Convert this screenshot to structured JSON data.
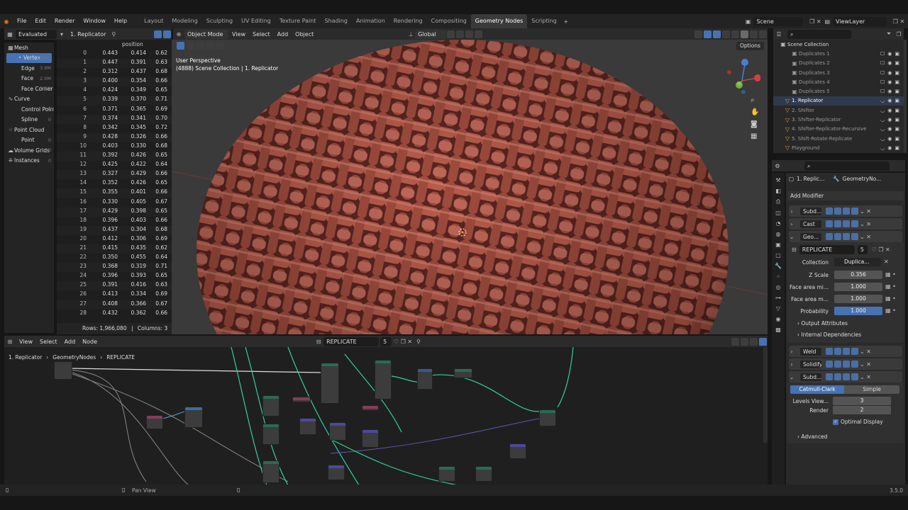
{
  "menu": [
    "File",
    "Edit",
    "Render",
    "Window",
    "Help"
  ],
  "workspaces": [
    "Layout",
    "Modeling",
    "Sculpting",
    "UV Editing",
    "Texture Paint",
    "Shading",
    "Animation",
    "Rendering",
    "Compositing",
    "Geometry Nodes",
    "Scripting"
  ],
  "active_workspace": "Geometry Nodes",
  "scene_name": "Scene",
  "view_layer": "ViewLayer",
  "spreadsheet": {
    "evaluated": "Evaluated",
    "object": "1. Replicator",
    "column_header": "position",
    "sidebar": [
      {
        "label": "Mesh",
        "count": ""
      },
      {
        "label": "Vertex",
        "count": "2.0M"
      },
      {
        "label": "Edge",
        "count": "3.9M"
      },
      {
        "label": "Face",
        "count": "2.0M"
      },
      {
        "label": "Face Corner",
        "count": "7.9M"
      },
      {
        "label": "Curve",
        "count": ""
      },
      {
        "label": "Control Point",
        "count": "0"
      },
      {
        "label": "Spline",
        "count": "0"
      },
      {
        "label": "Point Cloud",
        "count": ""
      },
      {
        "label": "Point",
        "count": "0"
      },
      {
        "label": "Volume Grids",
        "count": "0"
      },
      {
        "label": "Instances",
        "count": "0"
      }
    ],
    "rows": [
      [
        "0",
        "0.443",
        "0.414",
        "0.62"
      ],
      [
        "1",
        "0.447",
        "0.391",
        "0.63"
      ],
      [
        "2",
        "0.312",
        "0.437",
        "0.68"
      ],
      [
        "3",
        "0.400",
        "0.354",
        "0.66"
      ],
      [
        "4",
        "0.424",
        "0.349",
        "0.65"
      ],
      [
        "5",
        "0.339",
        "0.370",
        "0.71"
      ],
      [
        "6",
        "0.371",
        "0.365",
        "0.69"
      ],
      [
        "7",
        "0.374",
        "0.341",
        "0.70"
      ],
      [
        "8",
        "0.342",
        "0.345",
        "0.72"
      ],
      [
        "9",
        "0.428",
        "0.326",
        "0.66"
      ],
      [
        "10",
        "0.403",
        "0.330",
        "0.68"
      ],
      [
        "11",
        "0.392",
        "0.426",
        "0.65"
      ],
      [
        "12",
        "0.425",
        "0.422",
        "0.64"
      ],
      [
        "13",
        "0.327",
        "0.429",
        "0.66"
      ],
      [
        "14",
        "0.352",
        "0.426",
        "0.65"
      ],
      [
        "15",
        "0.355",
        "0.401",
        "0.66"
      ],
      [
        "16",
        "0.330",
        "0.405",
        "0.67"
      ],
      [
        "17",
        "0.429",
        "0.398",
        "0.65"
      ],
      [
        "18",
        "0.396",
        "0.403",
        "0.66"
      ],
      [
        "19",
        "0.437",
        "0.304",
        "0.68"
      ],
      [
        "20",
        "0.412",
        "0.306",
        "0.69"
      ],
      [
        "21",
        "0.415",
        "0.435",
        "0.62"
      ],
      [
        "22",
        "0.350",
        "0.455",
        "0.64"
      ],
      [
        "23",
        "0.368",
        "0.319",
        "0.71"
      ],
      [
        "24",
        "0.396",
        "0.393",
        "0.65"
      ],
      [
        "25",
        "0.391",
        "0.416",
        "0.63"
      ],
      [
        "26",
        "0.413",
        "0.334",
        "0.69"
      ],
      [
        "27",
        "0.408",
        "0.366",
        "0.67"
      ],
      [
        "28",
        "0.432",
        "0.362",
        "0.66"
      ]
    ],
    "footer_rows": "Rows: 1,966,080",
    "footer_cols": "Columns: 3"
  },
  "viewport": {
    "mode": "Object Mode",
    "menus": [
      "View",
      "Select",
      "Add",
      "Object"
    ],
    "orientation": "Global",
    "options": "Options",
    "info_line1": "User Perspective",
    "info_line2": "(4888) Scene Collection | 1. Replicator"
  },
  "node_editor": {
    "menus": [
      "View",
      "Select",
      "Add",
      "Node"
    ],
    "tree_name": "REPLICATE",
    "users": "5",
    "breadcrumb": [
      "1. Replicator",
      "GeometryNodes",
      "REPLICATE"
    ]
  },
  "outliner": {
    "root": "Scene Collection",
    "items": [
      "Duplicates 1",
      "Duplicates 2",
      "Duplicates 3",
      "Duplicates 4",
      "Duplicates 5",
      "1. Replicator",
      "2. Shifter",
      "3. Shifter-Replicator",
      "4. Shifter-Replicator-Recursive",
      "5. Shift-Rotate-Replicate",
      "Playground"
    ]
  },
  "properties": {
    "object": "1. Replic...",
    "modifier_name": "GeometryNo...",
    "add_modifier": "Add Modifier",
    "modifiers": [
      "Subd...",
      "Cast",
      "Geo..."
    ],
    "node_group": "REPLICATE",
    "node_group_users": "5",
    "collection_label": "Collection",
    "collection_value": "Duplica...",
    "inputs": [
      {
        "label": "Z Scale",
        "value": "0.356"
      },
      {
        "label": "Face area mi...",
        "value": "1.000"
      },
      {
        "label": "Face area m...",
        "value": "1.000"
      },
      {
        "label": "Probability",
        "value": "1.000"
      }
    ],
    "output_attributes": "Output Attributes",
    "internal_deps": "Internal Dependencies",
    "modifiers_after": [
      "Weld",
      "Solidify",
      "Subd..."
    ],
    "subsurf_tabs": [
      "Catmull-Clark",
      "Simple"
    ],
    "levels_label": "Levels View...",
    "levels_value": "3",
    "render_label": "Render",
    "render_value": "2",
    "optimal_display": "Optimal Display",
    "advanced": "Advanced"
  },
  "status": {
    "pan": "Pan View",
    "version": "3.5.0"
  },
  "colors": {
    "accent": "#4772b3",
    "weave": "#b45a4a"
  }
}
